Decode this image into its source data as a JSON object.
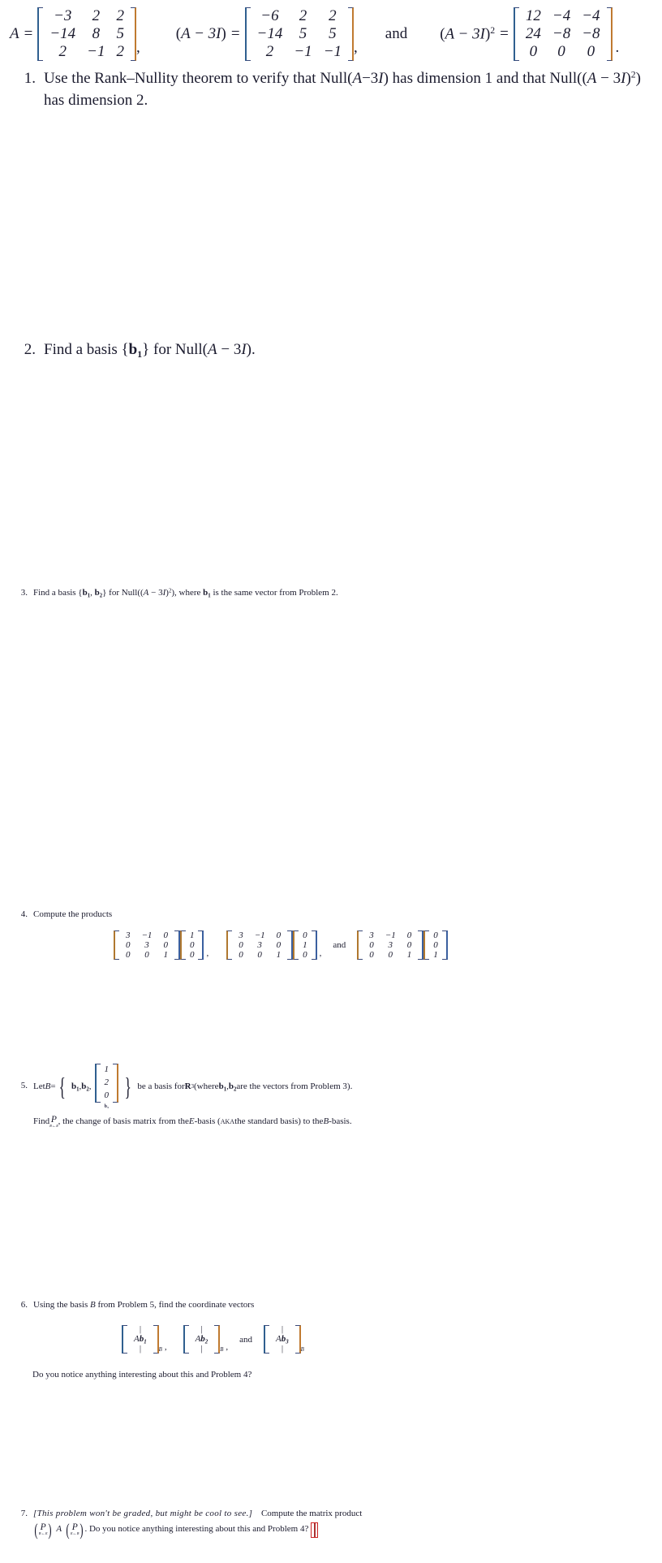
{
  "document": {
    "type": "linear-algebra-worksheet",
    "matrix_bracket_color": "#3a4a7a",
    "caret_color": "#cc2222"
  },
  "header": {
    "A_label": "A",
    "equals": "=",
    "A_matrix": [
      [
        "−3",
        "2",
        "2"
      ],
      [
        "−14",
        "8",
        "5"
      ],
      [
        "2",
        "−1",
        "2"
      ]
    ],
    "comma1": ",",
    "AminusI_label_open": "(",
    "AminusI_label": "A − 3I",
    "AminusI_label_close": ")",
    "AminusI_matrix": [
      [
        "−6",
        "2",
        "2"
      ],
      [
        "−14",
        "5",
        "5"
      ],
      [
        "2",
        "−1",
        "−1"
      ]
    ],
    "comma2": ",",
    "and_text": "and",
    "AminusI_sq_label_open": "(",
    "AminusI_sq_label": "A − 3I",
    "AminusI_sq_label_close": ")",
    "AminusI_sq_exponent": "2",
    "AminusI_sq_matrix": [
      [
        "12",
        "−4",
        "−4"
      ],
      [
        "24",
        "−8",
        "−8"
      ],
      [
        "0",
        "0",
        "0"
      ]
    ],
    "period": "."
  },
  "problems": [
    {
      "number": "1.",
      "line1_a": "Use the Rank–Nullity theorem to verify that Null(",
      "line1_A": "A",
      "line1_b": "−3",
      "line1_I": "I",
      "line1_c": ") has dimension 1 and that Null((",
      "line1_A2": "A",
      "line1_d": " − 3",
      "line1_I2": "I",
      "line1_e": ")",
      "line1_exp": "2",
      "line1_f": ")",
      "line2": "has dimension 2."
    },
    {
      "number": "2.",
      "text_a": "Find a basis {",
      "b1": "b",
      "b1_sub": "1",
      "text_b": "} for Null(",
      "A": "A",
      "text_c": " − 3",
      "I": "I",
      "text_d": ")."
    },
    {
      "number": "3.",
      "text_a": "Find a basis {",
      "b1": "b",
      "b1_sub": "1",
      "comma": ", ",
      "b2": "b",
      "b2_sub": "2",
      "text_b": "} for Null((",
      "A": "A",
      "text_c": " − 3",
      "I": "I",
      "text_d": ")",
      "exp": "2",
      "text_e": "), where ",
      "b1b": "b",
      "b1b_sub": "1",
      "text_f": " is the same vector from Problem 2."
    },
    {
      "number": "4.",
      "text": "Compute the products",
      "products": [
        {
          "matrix": [
            [
              "3",
              "−1",
              "0"
            ],
            [
              "0",
              "3",
              "0"
            ],
            [
              "0",
              "0",
              "1"
            ]
          ],
          "vector": [
            "1",
            "0",
            "0"
          ],
          "separator": ","
        },
        {
          "matrix": [
            [
              "3",
              "−1",
              "0"
            ],
            [
              "0",
              "3",
              "0"
            ],
            [
              "0",
              "0",
              "1"
            ]
          ],
          "vector": [
            "0",
            "1",
            "0"
          ],
          "separator": ","
        },
        {
          "matrix": [
            [
              "3",
              "−1",
              "0"
            ],
            [
              "0",
              "3",
              "0"
            ],
            [
              "0",
              "0",
              "1"
            ]
          ],
          "vector": [
            "0",
            "0",
            "1"
          ],
          "separator": ""
        }
      ],
      "and_text": "and"
    },
    {
      "number": "5.",
      "let_text": "Let ",
      "B_symbol": "B",
      "equals": " = ",
      "b1": "b",
      "b1_sub": "1",
      "comma1": ", ",
      "b2": "b",
      "b2_sub": "2",
      "comma2": ",",
      "b3_vector": [
        "1",
        "2",
        "0"
      ],
      "b3_label": "b₃",
      "text_a": " be a basis for ",
      "R": "R",
      "R_exp": "3",
      "text_b": " (where ",
      "b1c": "b",
      "b1c_sub": "1",
      "comma3": ", ",
      "b2c": "b",
      "b2c_sub": "2",
      "text_c": " are the vectors from Problem 3).",
      "line2_a": "Find ",
      "P_letter": "P",
      "P_sub": "ʙ←ᴇ",
      "line2_b": ", the change of basis matrix from the ",
      "E_symbol": "E",
      "line2_c": "-basis (",
      "aka": "aka",
      "line2_d": " the standard basis) to the ",
      "B_symbol2": "B",
      "line2_e": "-basis."
    },
    {
      "number": "6.",
      "text_a": "Using the basis ",
      "B_symbol": "B",
      "text_b": " from Problem 5, find the coordinate vectors",
      "vectors": [
        {
          "label_A": "A",
          "label_b": "b",
          "label_sub": "1",
          "basis_sub": "B",
          "separator": ","
        },
        {
          "label_A": "A",
          "label_b": "b",
          "label_sub": "2",
          "basis_sub": "B",
          "separator": ","
        },
        {
          "label_A": "A",
          "label_b": "b",
          "label_sub": "3",
          "basis_sub": "B",
          "separator": ""
        }
      ],
      "and_text": "and",
      "question": "Do you notice anything interesting about this and Problem 4?"
    },
    {
      "number": "7.",
      "bracket_note": "[This problem won't be graded, but might be cool to see.]",
      "text_a": "Compute the matrix product",
      "P1_letter": "P",
      "P1_sub": "ʙ←ᴇ",
      "A_letter": "A",
      "P2_letter": "P",
      "P2_sub": "ᴇ←ʙ",
      "text_b": ". Do you notice anything interesting about this and Problem 4?"
    }
  ]
}
